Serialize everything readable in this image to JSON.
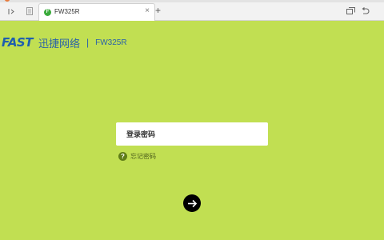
{
  "browser": {
    "tab_title": "FW325R",
    "favicon_letter": "F",
    "close_glyph": "×",
    "new_tab_glyph": "+",
    "accent": "#3bab3c"
  },
  "header": {
    "logo": "FAST",
    "brand_name": "迅捷网络",
    "separator": "|",
    "model": "FW325R",
    "brand_color": "#1f5fae"
  },
  "login": {
    "password_placeholder": "登录密码",
    "help_glyph": "?",
    "forgot_label": "忘记密码",
    "submit_icon": "arrow-right-icon"
  },
  "theme": {
    "background": "#c1df52"
  }
}
